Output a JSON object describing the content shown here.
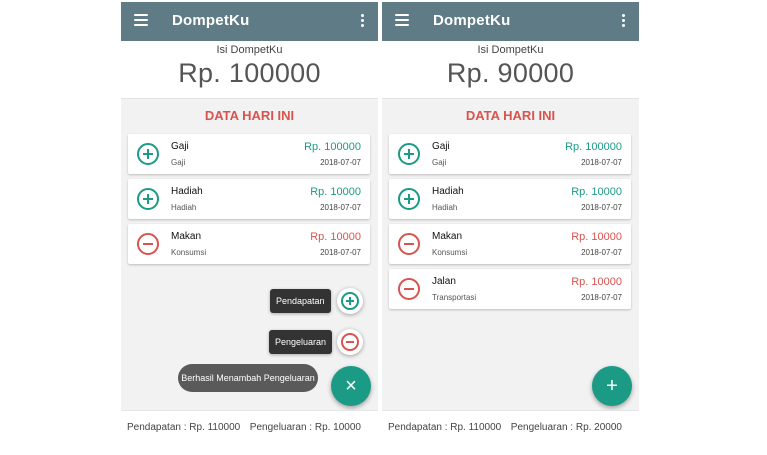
{
  "colors": {
    "appbar": "#5f7c86",
    "income": "#1b9a86",
    "expense": "#d9534f",
    "toast": "#5a5a5a"
  },
  "screens": [
    {
      "app_title": "DompetKu",
      "balance_label": "Isi DompetKu",
      "balance": "Rp. 100000",
      "section_title": "DATA HARI INI",
      "transactions": [
        {
          "type": "income",
          "icon": "plus-circle-icon",
          "name": "Gaji",
          "category": "Gaji",
          "amount": "Rp. 100000",
          "date": "2018-07-07"
        },
        {
          "type": "income",
          "icon": "plus-circle-icon",
          "name": "Hadiah",
          "category": "Hadiah",
          "amount": "Rp. 10000",
          "date": "2018-07-07"
        },
        {
          "type": "expense",
          "icon": "minus-circle-icon",
          "name": "Makan",
          "category": "Konsumsi",
          "amount": "Rp. 10000",
          "date": "2018-07-07"
        }
      ],
      "fab_menu": {
        "income_label": "Pendapatan",
        "expense_label": "Pengeluaran",
        "close_icon": "×"
      },
      "toast": "Berhasil Menambah Pengeluaran",
      "footer": {
        "income": "Pendapatan : Rp. 110000",
        "expense": "Pengeluaran : Rp. 10000"
      }
    },
    {
      "app_title": "DompetKu",
      "balance_label": "Isi DompetKu",
      "balance": "Rp. 90000",
      "section_title": "DATA HARI INI",
      "transactions": [
        {
          "type": "income",
          "icon": "plus-circle-icon",
          "name": "Gaji",
          "category": "Gaji",
          "amount": "Rp. 100000",
          "date": "2018-07-07"
        },
        {
          "type": "income",
          "icon": "plus-circle-icon",
          "name": "Hadiah",
          "category": "Hadiah",
          "amount": "Rp. 10000",
          "date": "2018-07-07"
        },
        {
          "type": "expense",
          "icon": "minus-circle-icon",
          "name": "Makan",
          "category": "Konsumsi",
          "amount": "Rp. 10000",
          "date": "2018-07-07"
        },
        {
          "type": "expense",
          "icon": "minus-circle-icon",
          "name": "Jalan",
          "category": "Transportasi",
          "amount": "Rp. 10000",
          "date": "2018-07-07"
        }
      ],
      "fab_icon": "+",
      "footer": {
        "income": "Pendapatan : Rp. 110000",
        "expense": "Pengeluaran : Rp. 20000"
      }
    }
  ]
}
